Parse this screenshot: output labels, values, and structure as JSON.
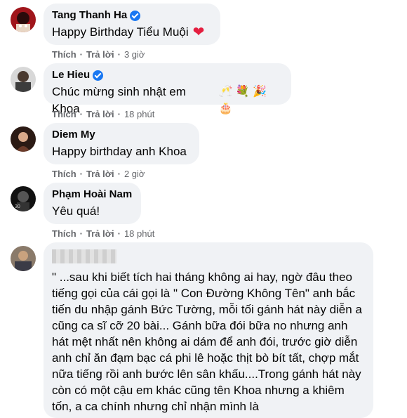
{
  "comments": [
    {
      "name": "Tang Thanh Ha",
      "verified": true,
      "text": "Happy Birthday Tiểu Muội",
      "emoji": "❤",
      "like": "Thích",
      "reply": "Trả lời",
      "time": "3 giờ"
    },
    {
      "name": "Le Hieu",
      "verified": true,
      "text": "Chúc mừng sinh nhật em Khoa",
      "emoji": "🥂 💐 🎉 🎂",
      "like": "Thích",
      "reply": "Trả lời",
      "time": "18 phút"
    },
    {
      "name": "Diem My",
      "verified": false,
      "text": "Happy birthday anh Khoa",
      "like": "Thích",
      "reply": "Trả lời",
      "time": "2 giờ"
    },
    {
      "name": "Phạm Hoài Nam",
      "verified": false,
      "text": "Yêu quá!",
      "like": "Thích",
      "reply": "Trả lời",
      "time": "18 phút"
    },
    {
      "name": "",
      "verified": false,
      "text": "\" ...sau khi biết tích hai tháng không ai hay, ngờ đâu theo tiếng gọi của cái gọi là \" Con Đường Không Tên\" anh bắc tiến du nhập gánh Bức Tường, mỗi tối gánh hát này diễn a cũng ca sĩ cỡ 20 bài... Gánh bữa đói bữa no nhưng anh hát mệt nhất nên không ai dám để anh đói, trước giờ diễn anh chỉ ăn đạm bạc cá phi lê hoặc thịt bò bít tất, chợp mắt nữa tiếng rồi anh bước lên sân khấu....Trong gánh hát này còn có một cậu em khác cũng tên Khoa nhưng a khiêm tốn, a ca chính nhưng chỉ nhận mình là"
    }
  ],
  "colors": {
    "bubble": "#f0f2f5",
    "verified": "#1877f2",
    "meta": "#65676b",
    "heart": "#e41e3f"
  }
}
